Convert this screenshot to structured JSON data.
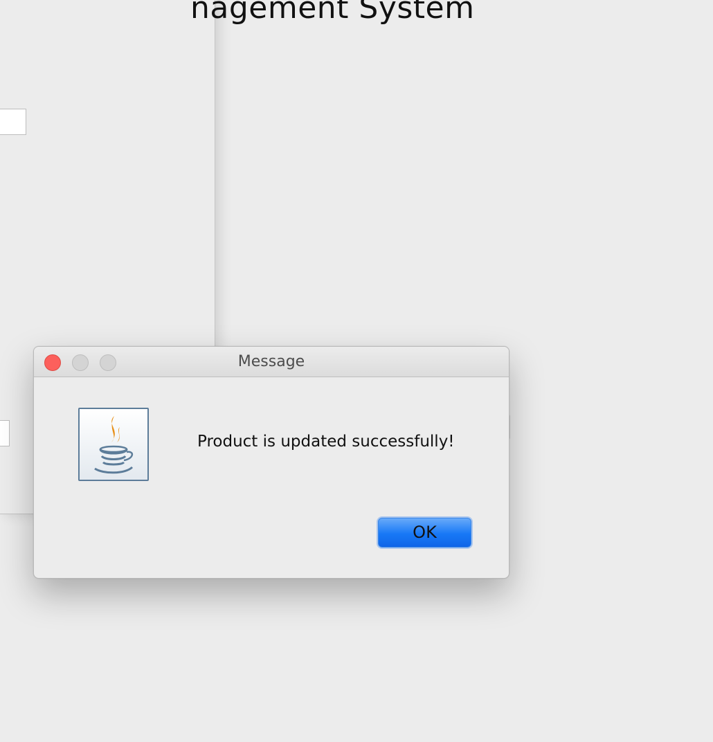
{
  "background_window": {
    "title": "nagement System"
  },
  "dialog": {
    "title": "Message",
    "icon": "java-coffee-cup-icon",
    "message": "Product is updated successfully!",
    "ok_label": "OK",
    "colors": {
      "close_button": "#fc605c",
      "inactive_button": "#d4d4d4",
      "ok_button": "#1778f6"
    }
  }
}
